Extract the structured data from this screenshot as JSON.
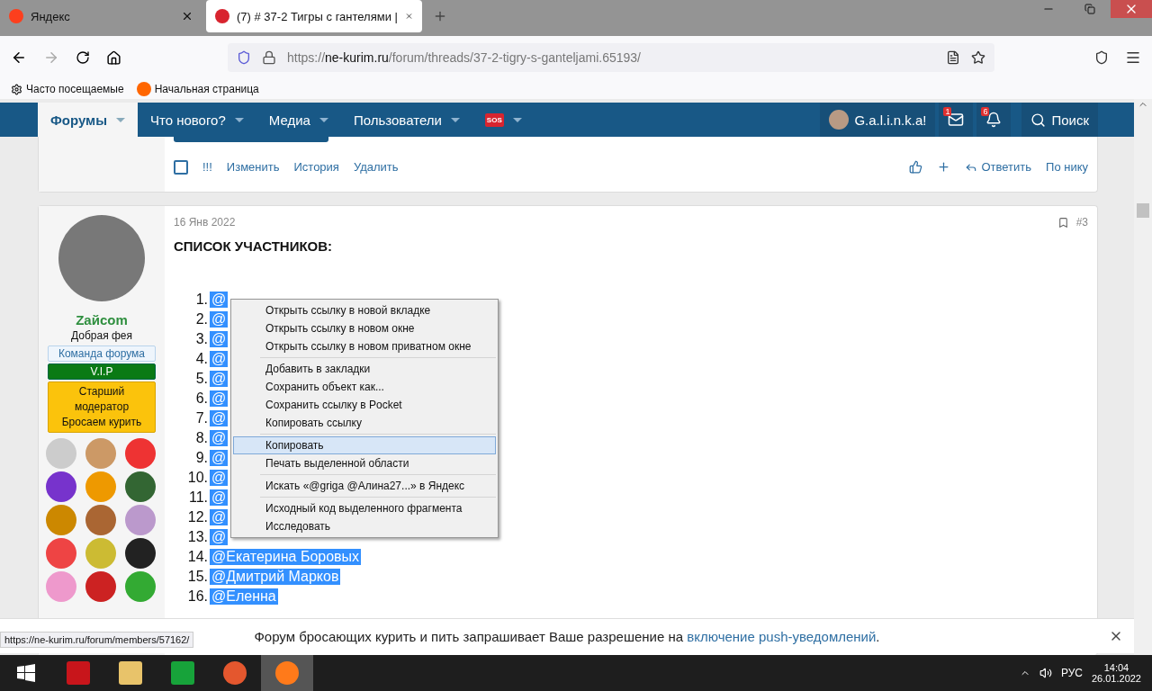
{
  "browser": {
    "tabs": [
      {
        "title": "Яндекс",
        "selected": false
      },
      {
        "title": "(7) # 37-2 Тигры с гантелями |",
        "selected": true
      }
    ],
    "url": {
      "host": "ne-kurim.ru",
      "prefix": "https://",
      "path": "/forum/threads/37-2-tigry-s-ganteljami.65193/"
    },
    "bookmarks": [
      "Часто посещаемые",
      "Начальная страница"
    ]
  },
  "nav": {
    "items": [
      {
        "label": "Форумы",
        "selected": true
      },
      {
        "label": "Что нового?",
        "selected": false
      },
      {
        "label": "Медиа",
        "selected": false
      },
      {
        "label": "Пользователи",
        "selected": false
      },
      {
        "label": "SOS",
        "selected": false
      }
    ],
    "user": "G.a.l.i.n.k.a!",
    "messages_badge": "1",
    "alerts_badge": "6",
    "search": "Поиск"
  },
  "prev_post": {
    "checked": false,
    "actions": [
      "!!!",
      "Изменить",
      "История",
      "Удалить"
    ],
    "reply": "Ответить",
    "by_nick": "По нику"
  },
  "post": {
    "date": "16 Янв 2022",
    "number": "#3",
    "author": "Zaйcom",
    "user_title": "Добрая фея",
    "banners": [
      {
        "kind": "team",
        "text": "Команда форума"
      },
      {
        "kind": "vip",
        "text": "V.I.P"
      },
      {
        "kind": "moderator",
        "text": "Старший модератор Бросаем курить"
      }
    ],
    "title": "СПИСОК УЧАСТНИКОВ:",
    "list": [
      {
        "num": "1.",
        "text": "@"
      },
      {
        "num": "2.",
        "text": "@"
      },
      {
        "num": "3.",
        "text": "@"
      },
      {
        "num": "4.",
        "text": "@"
      },
      {
        "num": "5.",
        "text": "@"
      },
      {
        "num": "6.",
        "text": "@"
      },
      {
        "num": "7.",
        "text": "@"
      },
      {
        "num": "8.",
        "text": "@"
      },
      {
        "num": "9.",
        "text": "@"
      },
      {
        "num": "10.",
        "text": "@"
      },
      {
        "num": "11.",
        "text": "@"
      },
      {
        "num": "12.",
        "text": "@"
      },
      {
        "num": "13.",
        "text": "@"
      },
      {
        "num": "14.",
        "text": "@Екатерина Боровых"
      },
      {
        "num": "15.",
        "text": "@Дмитрий Марков"
      },
      {
        "num": "16.",
        "text": "@Еленна"
      }
    ]
  },
  "context_menu": [
    [
      {
        "label": "Открыть ссылку в новой вкладке",
        "selected": false
      },
      {
        "label": "Открыть ссылку в новом окне",
        "selected": false
      },
      {
        "label": "Открыть ссылку в новом приватном окне",
        "selected": false
      }
    ],
    [
      {
        "label": "Добавить в закладки",
        "selected": false
      },
      {
        "label": "Сохранить объект как...",
        "selected": false
      },
      {
        "label": "Сохранить ссылку в Pocket",
        "selected": false
      },
      {
        "label": "Копировать ссылку",
        "selected": false
      }
    ],
    [
      {
        "label": "Копировать",
        "selected": true
      },
      {
        "label": "Печать выделенной области",
        "selected": false
      }
    ],
    [
      {
        "label": "Искать «@griga @Алина27...» в Яндекс",
        "selected": false
      }
    ],
    [
      {
        "label": "Исходный код выделенного фрагмента",
        "selected": false
      },
      {
        "label": "Исследовать",
        "selected": false
      }
    ]
  ],
  "notice": {
    "text": "Форум бросающих курить и пить запрашивает Ваше разрешение на ",
    "link": "включение push-уведомлений",
    "end": "."
  },
  "status_url": "https://ne-kurim.ru/forum/members/57162/",
  "taskbar": {
    "language": "РУС",
    "time": "14:04",
    "date": "26.01.2022"
  }
}
